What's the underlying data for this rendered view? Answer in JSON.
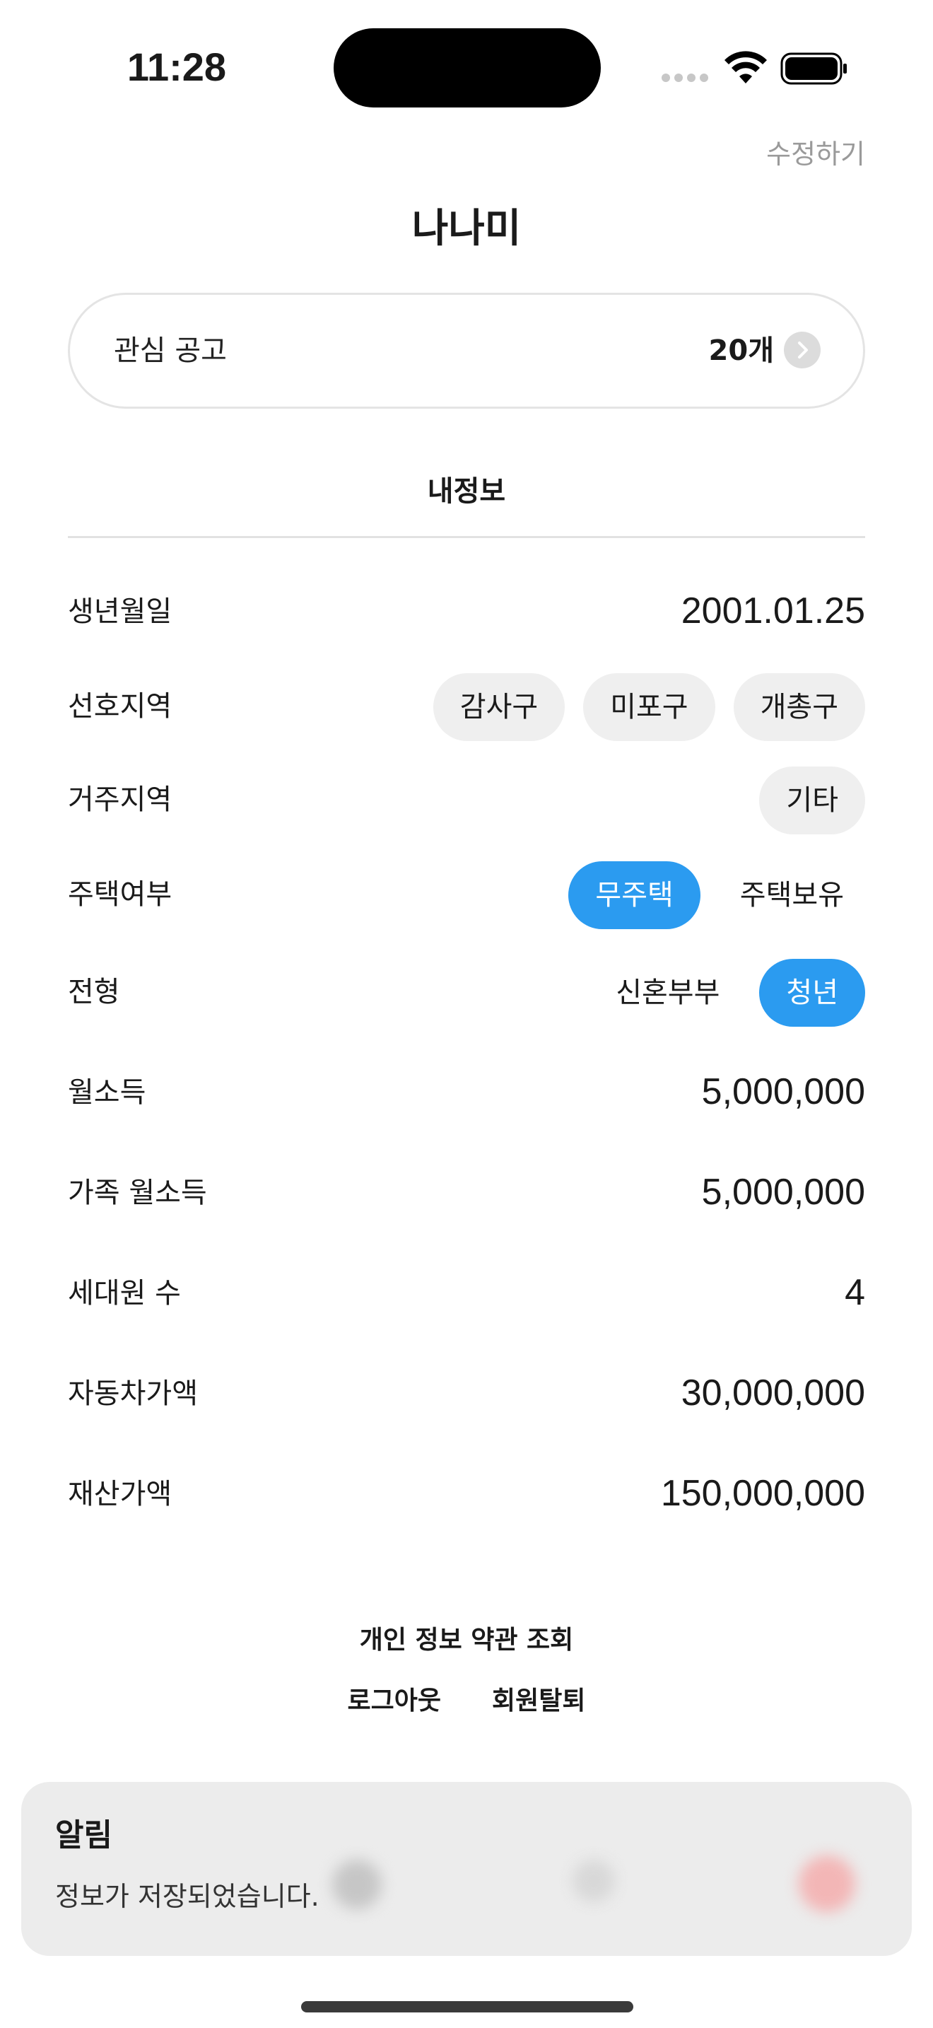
{
  "status_bar": {
    "time": "11:28"
  },
  "header": {
    "edit_label": "수정하기",
    "title": "나나미"
  },
  "interest": {
    "label": "관심 공고",
    "count": "20개"
  },
  "section": {
    "title": "내정보"
  },
  "profile": {
    "birth": {
      "label": "생년월일",
      "value": "2001.01.25"
    },
    "preferred_region": {
      "label": "선호지역",
      "chips": [
        "감사구",
        "미포구",
        "개총구"
      ]
    },
    "residence_region": {
      "label": "거주지역",
      "chips": [
        "기타"
      ]
    },
    "housing": {
      "label": "주택여부",
      "options": [
        "무주택",
        "주택보유"
      ],
      "selected": "무주택"
    },
    "type": {
      "label": "전형",
      "options": [
        "신혼부부",
        "청년"
      ],
      "selected": "청년"
    },
    "monthly_income": {
      "label": "월소득",
      "value": "5,000,000"
    },
    "family_income": {
      "label": "가족 월소득",
      "value": "5,000,000"
    },
    "household_size": {
      "label": "세대원 수",
      "value": "4"
    },
    "car_value": {
      "label": "자동차가액",
      "value": "30,000,000"
    },
    "property_value": {
      "label": "재산가액",
      "value": "150,000,000"
    }
  },
  "footer": {
    "privacy_label": "개인 정보 약관 조회",
    "logout_label": "로그아웃",
    "withdraw_label": "회원탈퇴"
  },
  "toast": {
    "title": "알림",
    "message": "정보가 저장되었습니다."
  },
  "colors": {
    "accent": "#2b9bf0",
    "chip_bg": "#efefef",
    "toast_bg": "#ececec"
  }
}
